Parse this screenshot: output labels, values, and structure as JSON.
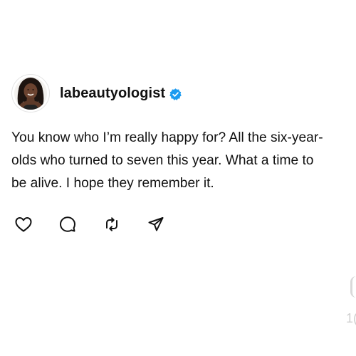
{
  "post": {
    "username": "labeautyologist",
    "verified": true,
    "body": "You know who I’m really happy for? All the six-year-olds who turned to seven this year. What a time to be alive. I hope they remember it.",
    "actions": [
      "like",
      "comment",
      "repost",
      "share"
    ]
  },
  "colors": {
    "text": "#111111",
    "verified_badge": "#1d9bf0",
    "icon": "#111111"
  },
  "edge": {
    "partial_number": "1("
  }
}
